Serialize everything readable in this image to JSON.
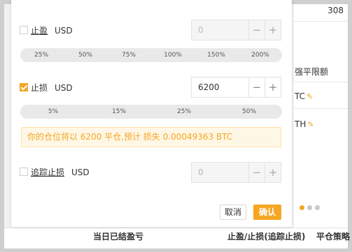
{
  "background": {
    "top_number": "308",
    "limit_label": "强平限额",
    "row1_text": "TC",
    "row2_text": "TH",
    "bottom_cols": [
      "当日已结盈亏",
      "止盈/止损(追踪止损)",
      "平仓策略"
    ]
  },
  "take_profit": {
    "label": "止盈",
    "unit": "USD",
    "checked": false,
    "value": "0",
    "percents": [
      "25%",
      "50%",
      "75%",
      "100%",
      "150%",
      "200%"
    ]
  },
  "stop_loss": {
    "label": "止损",
    "unit": "USD",
    "checked": true,
    "value": "6200",
    "percents": [
      "5%",
      "15%",
      "25%",
      "50%"
    ]
  },
  "notice": "你的仓位将以 6200 平仓,预计 损失 0.00049363 BTC",
  "trailing_stop": {
    "label": "追踪止损",
    "unit": "USD",
    "checked": false,
    "value": "0"
  },
  "stepper": {
    "minus": "−",
    "plus": "+"
  },
  "buttons": {
    "cancel": "取消",
    "confirm": "确认"
  },
  "colors": {
    "accent": "#f5a623",
    "notice_bg": "#fff7e6"
  }
}
